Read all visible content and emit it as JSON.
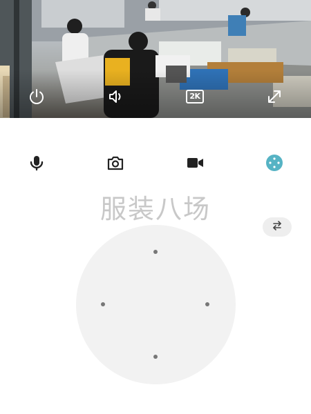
{
  "video": {
    "quality_label": "2K",
    "icons": [
      "power-icon",
      "volume-icon",
      "fullscreen-icon"
    ]
  },
  "controls": {
    "icons": [
      "microphone-icon",
      "camera-icon",
      "video-record-icon",
      "ptz-control-icon"
    ],
    "active_color": "#56b3c4"
  },
  "title": "服装八场",
  "ptz": {
    "swap_icon": "swap-arrows-icon",
    "directions": [
      "up",
      "left",
      "right",
      "down"
    ]
  }
}
